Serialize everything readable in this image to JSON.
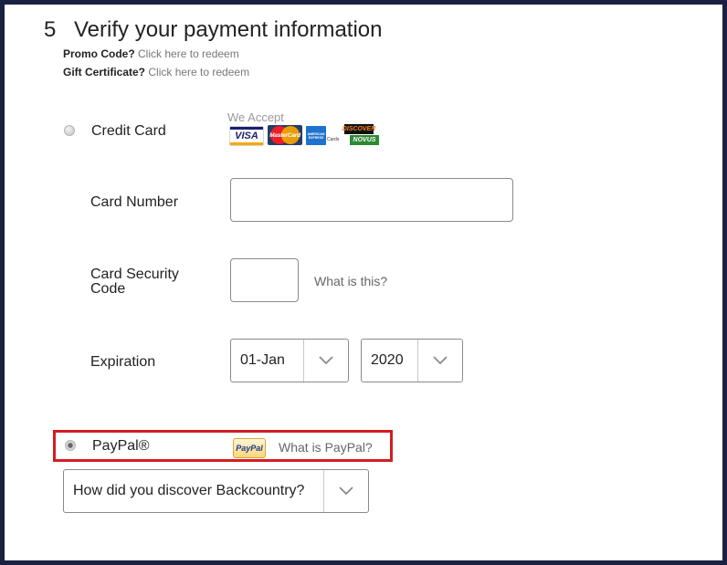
{
  "step": {
    "number": "5",
    "title": "Verify your payment information"
  },
  "promo": {
    "label": "Promo Code?",
    "link": "Click here to redeem"
  },
  "gift": {
    "label": "Gift Certificate?",
    "link": "Click here to redeem"
  },
  "credit_card": {
    "option_label": "Credit Card",
    "we_accept": "We Accept",
    "logos": {
      "visa": "VISA",
      "mastercard": "MasterCard",
      "amex": "AMERICAN EXPRESS",
      "discover": "DISCOVER",
      "novus": "NOVUS"
    },
    "card_number_label": "Card Number",
    "card_number_value": "",
    "security_label": "Card Security Code",
    "security_value": "",
    "what_is_this": "What is this?",
    "expiration_label": "Expiration",
    "exp_month": "01-Jan",
    "exp_year": "2020"
  },
  "paypal": {
    "option_label": "PayPal®",
    "logo_text": "PayPal",
    "what_is": "What is PayPal?",
    "selected": true
  },
  "discover": {
    "selected_value": "How did you discover Backcountry?"
  },
  "colors": {
    "frame": "#1b2140",
    "highlight_border": "#d41c22",
    "link_gray": "#777777"
  }
}
